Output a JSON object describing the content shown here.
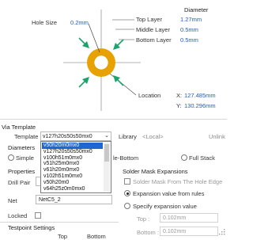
{
  "diagram": {
    "hole_size_label": "Hole Size",
    "hole_size_value": "0.2mm",
    "diameter_title": "Diameter",
    "top_layer_label": "Top Layer",
    "top_layer_value": "1.27mm",
    "middle_layer_label": "Middle Layer",
    "middle_layer_value": "0.5mm",
    "bottom_layer_label": "Bottom Layer",
    "bottom_layer_value": "0.5mm",
    "location_label": "Location",
    "x_label": "X:",
    "x_value": "127.485mm",
    "y_label": "Y:",
    "y_value": "130.296mm",
    "colors": {
      "pad": "#e8a200",
      "arrow": "#1aa36a",
      "value": "#1f5fb8"
    }
  },
  "via_template": {
    "section_title": "Via Template",
    "template_label": "Template",
    "template_value": "v127h20s50s50mx0",
    "library_label": "Library",
    "library_value": "<Local>",
    "unlink_label": "Unlink",
    "options": [
      "v50h20m0mx0",
      "v127h20s50s50mx0",
      "v100h51m0mx0",
      "v51h25m0mx0",
      "v61h20m0mx0",
      "v102h51m0mx0",
      "v50h20m0",
      "v64h25z0m0mx0"
    ],
    "highlighted_index": 0
  },
  "diameters": {
    "section_title": "Diameters",
    "simple_label": "Simple",
    "top_middle_bottom_label": "le-Bottom",
    "full_stack_label": "Full Stack"
  },
  "properties": {
    "section_title": "Properties",
    "drill_pair_label": "Drill Pair",
    "net_label": "Net",
    "net_value": "NetC5_2",
    "locked_label": "Locked"
  },
  "solder_mask": {
    "section_title": "Solder Mask Expansions",
    "from_hole_edge_label": "Solder Mask From The Hole Edge",
    "from_rules_label": "Expansion value from rules",
    "specify_label": "Specify expansion value",
    "top_label": "Top :",
    "top_value": "0.102mm",
    "bottom_label": "Bottom :",
    "bottom_value": "0.102mm"
  },
  "testpoint": {
    "section_title": "Testpoint Settings",
    "col_top": "Top",
    "col_bottom": "Bottom"
  }
}
